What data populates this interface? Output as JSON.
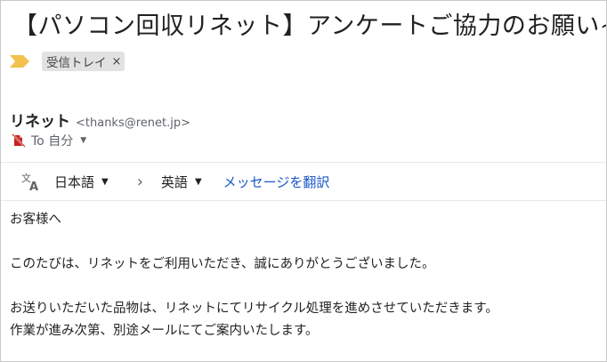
{
  "email": {
    "subject": "【パソコン回収リネット】アンケートご協力のお願い~",
    "label_chip": "受信トレイ",
    "label_close": "×",
    "sender_name": "リネット",
    "sender_email": "<thanks@renet.jp>",
    "to_text": "To 自分",
    "to_dropdown": "▼"
  },
  "translate": {
    "source_lang": "日本語",
    "target_lang": "英語",
    "caret": "▼",
    "arrow": "›",
    "translate_link": "メッセージを翻訳"
  },
  "body": {
    "greeting": "お客様へ",
    "line1": "このたびは、リネットをご利用いただき、誠にありがとうございました。",
    "line2": "お送りいただいた品物は、リネットにてリサイクル処理を進めさせていただきます。",
    "line3": "作業が進み次第、別途メールにてご案内いたします。"
  },
  "colors": {
    "importance": "#f2c14e",
    "link": "#1a57c8",
    "unverified_icon": "#c5221f"
  },
  "icons": [
    "importance-marker-icon",
    "translate-icon",
    "unverified-sender-icon",
    "chevron-right-icon"
  ]
}
